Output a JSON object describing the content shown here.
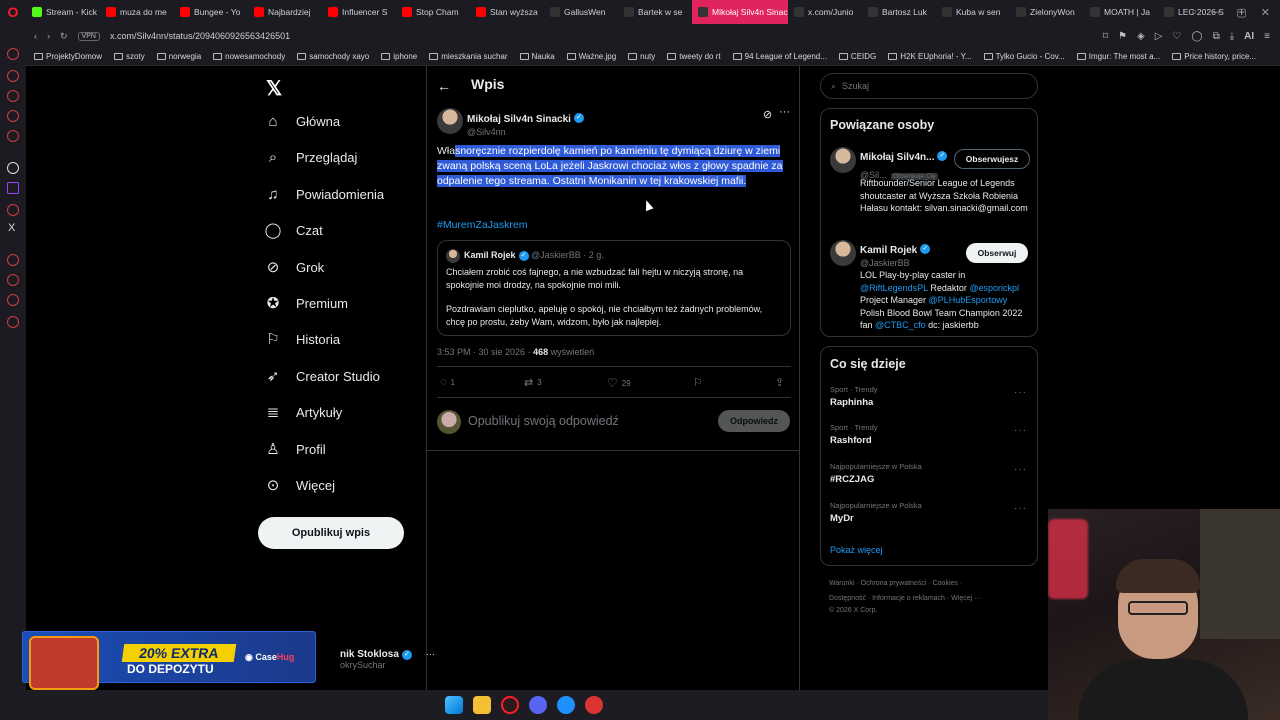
{
  "browser": {
    "tabs": [
      {
        "label": "Stream - Kick",
        "icon_color": "#53fc18",
        "active": false
      },
      {
        "label": "muza do me",
        "icon_color": "#ff0000",
        "active": false
      },
      {
        "label": "Bungee - Yo",
        "icon_color": "#ff0000",
        "active": false
      },
      {
        "label": "Najbardziej",
        "icon_color": "#ff0000",
        "active": false
      },
      {
        "label": "Influencer S",
        "icon_color": "#ff0000",
        "active": false
      },
      {
        "label": "Stop Cham",
        "icon_color": "#ff0000",
        "active": false
      },
      {
        "label": "Stan wyższa",
        "icon_color": "#ff0000",
        "active": false
      },
      {
        "label": "GallusWen",
        "icon_color": "#333333",
        "active": false
      },
      {
        "label": "Bartek w se",
        "icon_color": "#333333",
        "active": false
      },
      {
        "label": "Mikołaj Silv4n Sinacki",
        "icon_color": "#333333",
        "active": true
      },
      {
        "label": "x.com/Junio",
        "icon_color": "#333333",
        "active": false
      },
      {
        "label": "Bartosz Luk",
        "icon_color": "#333333",
        "active": false
      },
      {
        "label": "Kuba w sen",
        "icon_color": "#333333",
        "active": false
      },
      {
        "label": "ZielonyWon",
        "icon_color": "#333333",
        "active": false
      },
      {
        "label": "MOATH | Ja",
        "icon_color": "#333333",
        "active": false
      },
      {
        "label": "LEC 2026 S",
        "icon_color": "#333333",
        "active": false
      }
    ],
    "vpn_label": "VPN",
    "url": "x.com/Silv4nn/status/2094060926563426501",
    "ai_label": "AI",
    "bookmarks": [
      "ProjektyDomow",
      "szoty",
      "norwegia",
      "nowesamochody",
      "samochody xayo",
      "iphone",
      "mieszkania suchar",
      "Nauka",
      "Ważne.jpg",
      "nuty",
      "tweety do rt",
      "94 League of Legend...",
      "CEIDG",
      "H2K EUphoria! - Y...",
      "Tylko Gucio - Cov...",
      "Imgur: The most a...",
      "Price history, price..."
    ]
  },
  "nav": {
    "items": [
      {
        "label": "Główna",
        "icon": "home-icon"
      },
      {
        "label": "Przeglądaj",
        "icon": "search-icon"
      },
      {
        "label": "Powiadomienia",
        "icon": "bell-icon"
      },
      {
        "label": "Czat",
        "icon": "chat-icon"
      },
      {
        "label": "Grok",
        "icon": "grok-icon"
      },
      {
        "label": "Premium",
        "icon": "premium-icon"
      },
      {
        "label": "Historia",
        "icon": "bookmark-icon"
      },
      {
        "label": "Creator Studio",
        "icon": "rocket-icon"
      },
      {
        "label": "Artykuły",
        "icon": "article-icon"
      },
      {
        "label": "Profil",
        "icon": "user-icon"
      },
      {
        "label": "Więcej",
        "icon": "more-icon"
      }
    ],
    "post_button": "Opublikuj wpis",
    "account_name": "nik Stoklosa",
    "account_handle": "okrySuchar"
  },
  "ad": {
    "headline": "20% EXTRA",
    "subline": "DO DEPOZYTU",
    "brand_a": "Case",
    "brand_b": "Hug"
  },
  "post": {
    "header_title": "Wpis",
    "author_name": "Mikołaj Silv4n Sinacki",
    "author_handle": "@Silv4nn",
    "text_unselected": "Wła",
    "text_selected": "snoręcznie rozpierdolę kamień po kamieniu tę dymiącą dziurę w ziemi zwaną polską sceną LoLa jeżeli Jaskrowi chociaż włos z głowy spadnie za odpalenie tego streama. Ostatni Monikanin w tej krakowskiej mafii.",
    "hashtag": "#MuremZaJaskrem",
    "quote": {
      "name": "Kamil Rojek",
      "handle": "@JaskierBB",
      "time": "· 2 g.",
      "p1": "Chciałem zrobić coś fajnego, a nie wzbudzać fali hejtu w niczyją stronę, na spokojnie moi drodzy, na spokojnie moi mili.",
      "p2": "Pozdrawiam cieplutko, apeluję o spokój, nie chciałbym też żadnych problemów, chcę po prostu, żeby Wam, widzom, było jak najlepiej."
    },
    "time": "3:53 PM · 30 sie 2026 · ",
    "views": "468",
    "views_label": " wyświetleń",
    "replies": "1",
    "reposts": "3",
    "likes": "29",
    "reply_placeholder": "Opublikuj swoją odpowiedź",
    "reply_button": "Odpowiedz"
  },
  "sidebar": {
    "search_placeholder": "Szukaj",
    "related_title": "Powiązane osoby",
    "people": [
      {
        "name": "Mikołaj Silv4n...",
        "handle": "@Sil...",
        "follows_you": "Obserwuje Cię",
        "button": "Obserwujesz",
        "bio": "Riftbounder/Senior League of Legends shoutcaster at Wyższa Szkoła Robienia Hałasu kontakt: silvan.sinacki@gmail.com"
      },
      {
        "name": "Kamil Rojek",
        "handle": "@JaskierBB",
        "button": "Obserwuj",
        "bio_1": "LOL Play-by-play caster in ",
        "bio_link1": "@RiftLegendsPL",
        "bio_2": " Redaktor ",
        "bio_link2": "@esporickpl",
        "bio_3": " Project Manager ",
        "bio_link3": "@PLHubEsportowy",
        "bio_4": " Polish Blood Bowl Team Champion 2022 fan ",
        "bio_link4": "@CTBC_cfo",
        "bio_5": " dc: jaskierbb"
      }
    ],
    "trends_title": "Co się dzieje",
    "trends": [
      {
        "category": "Sport · Trendy",
        "name": "Raphinha"
      },
      {
        "category": "Sport · Trendy",
        "name": "Rashford"
      },
      {
        "category": "Najpopularniejsze w Polska",
        "name": "#RCZJAG"
      },
      {
        "category": "Najpopularniejsze w Polska",
        "name": "MyDr"
      }
    ],
    "show_more": "Pokaż więcej",
    "footer_1": "Warunki   ·   Ochrona prywatności   ·   Cookies   ·",
    "footer_2": "Dostępność   ·   Informacje o reklamach   ·   Więcej ···",
    "footer_3": "© 2026 X Corp."
  }
}
